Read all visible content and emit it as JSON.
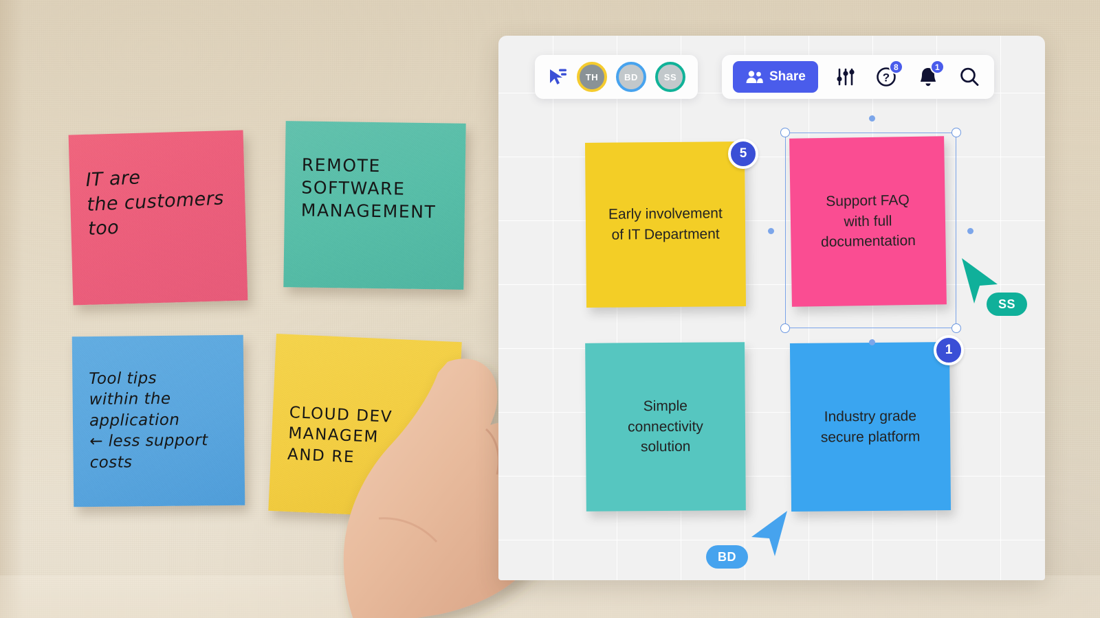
{
  "scene": {
    "description": "Physical sticky notes on a wall beside a digital whiteboard app panel",
    "wall_color": "#e4d9c4",
    "board_canvas_color": "#f1f1f1"
  },
  "physical_notes": [
    {
      "id": "pink",
      "color": "#ef5f7c",
      "style": "cursive",
      "text": "IT are\nthe customers\n     too"
    },
    {
      "id": "teal",
      "color": "#57bfa9",
      "style": "caps",
      "text": "REMOTE\n SOFTWARE\nMANAGEMENT"
    },
    {
      "id": "blue",
      "color": "#5aa7e0",
      "style": "cursive",
      "text": "Tool tips\nwithin the\napplication\n← less support\n      costs"
    },
    {
      "id": "yellow",
      "color": "#f5cf41",
      "style": "caps",
      "text": "CLOUD DEV\nMANAGEM\nAND RE"
    }
  ],
  "toolbar": {
    "cursor_tool": "pointer-select-icon",
    "avatars": [
      {
        "initials": "TH",
        "ring_color": "#f5cb2e",
        "fill_color": "#8a9296"
      },
      {
        "initials": "BD",
        "ring_color": "#47a3ee",
        "fill_color": "#c2c8cb"
      },
      {
        "initials": "SS",
        "ring_color": "#10b298",
        "fill_color": "#c2c8cb"
      }
    ],
    "share_label": "Share",
    "share_color": "#4a5ceb",
    "settings_icon": "sliders-icon",
    "help": {
      "icon": "question-circle-icon",
      "badge": "8"
    },
    "notifications": {
      "icon": "bell-icon",
      "badge": "1"
    },
    "search_icon": "search-icon"
  },
  "board_notes": [
    {
      "id": "yellow",
      "color": "#f3ce26",
      "text": "Early involvement\nof IT Department",
      "badge": "5",
      "selected": false
    },
    {
      "id": "pink",
      "color": "#fa4d92",
      "text": "Support FAQ\nwith full\ndocumentation",
      "badge": "",
      "selected": true
    },
    {
      "id": "teal",
      "color": "#56c6c0",
      "text": "Simple\nconnectivity\nsolution",
      "badge": "",
      "selected": false
    },
    {
      "id": "blue",
      "color": "#3aa5f0",
      "text": "Industry grade\nsecure platform",
      "badge": "1",
      "selected": false
    }
  ],
  "collaborators": [
    {
      "initials": "SS",
      "color": "#10b09a"
    },
    {
      "initials": "BD",
      "color": "#46a3ee"
    }
  ]
}
